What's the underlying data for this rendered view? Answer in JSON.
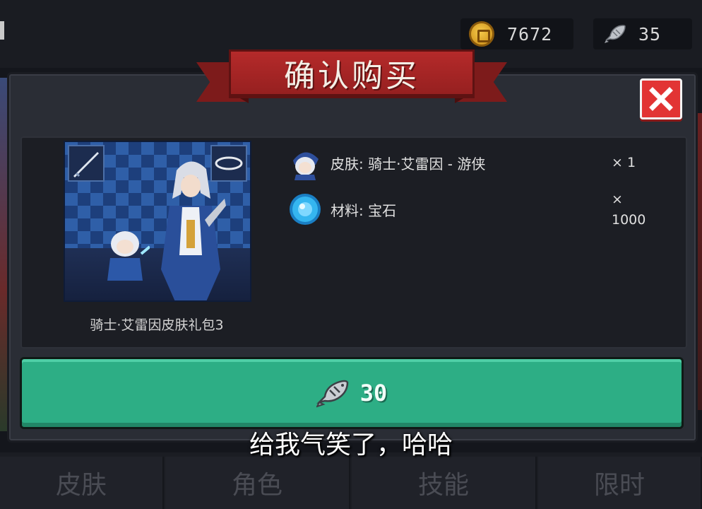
{
  "resources": {
    "coins": "7672",
    "fish": "35"
  },
  "dialog": {
    "title": "确认购买",
    "pack_name": "骑士·艾雷因皮肤礼包3",
    "items": [
      {
        "label": "皮肤: 骑士·艾雷因 - 游侠",
        "qty": "× 1"
      },
      {
        "label": "材料: 宝石",
        "qty_line1": "×",
        "qty_line2": "1000"
      }
    ],
    "price": "30"
  },
  "tabs": [
    "皮肤",
    "角色",
    "技能",
    "限时"
  ],
  "subtitle": "给我气笑了，哈哈",
  "colors": {
    "banner_red": "#b52a2a",
    "close_red": "#e23434",
    "buy_green": "#2dae85",
    "panel_dark": "#1c1e24"
  },
  "icons": {
    "coin": "coin-icon",
    "fish": "fish-icon",
    "close": "close-icon",
    "gem": "gem-icon",
    "skin": "knight-avatar-icon"
  }
}
